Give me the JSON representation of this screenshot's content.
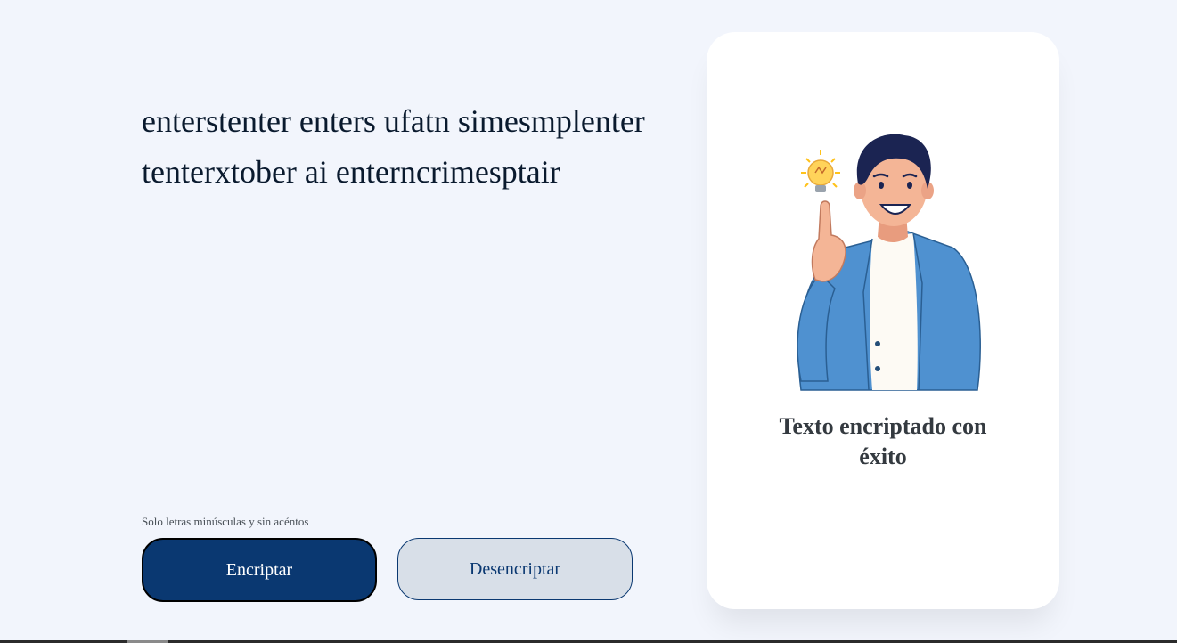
{
  "input": {
    "text": "enterstenter enters ufatn simesmplenter tenterxtober ai enterncrimesptair"
  },
  "hint": {
    "text": "Solo letras minúsculas y sin acéntos"
  },
  "buttons": {
    "encrypt_label": "Encriptar",
    "decrypt_label": "Desencriptar"
  },
  "result": {
    "title": "Texto encriptado con éxito"
  },
  "colors": {
    "primary": "#0a3871",
    "background": "#f2f5fc",
    "card": "#ffffff",
    "secondary_button": "#d8dfe8"
  },
  "icons": {
    "illustration": "person-with-idea-illustration",
    "lightbulb": "lightbulb-icon"
  }
}
